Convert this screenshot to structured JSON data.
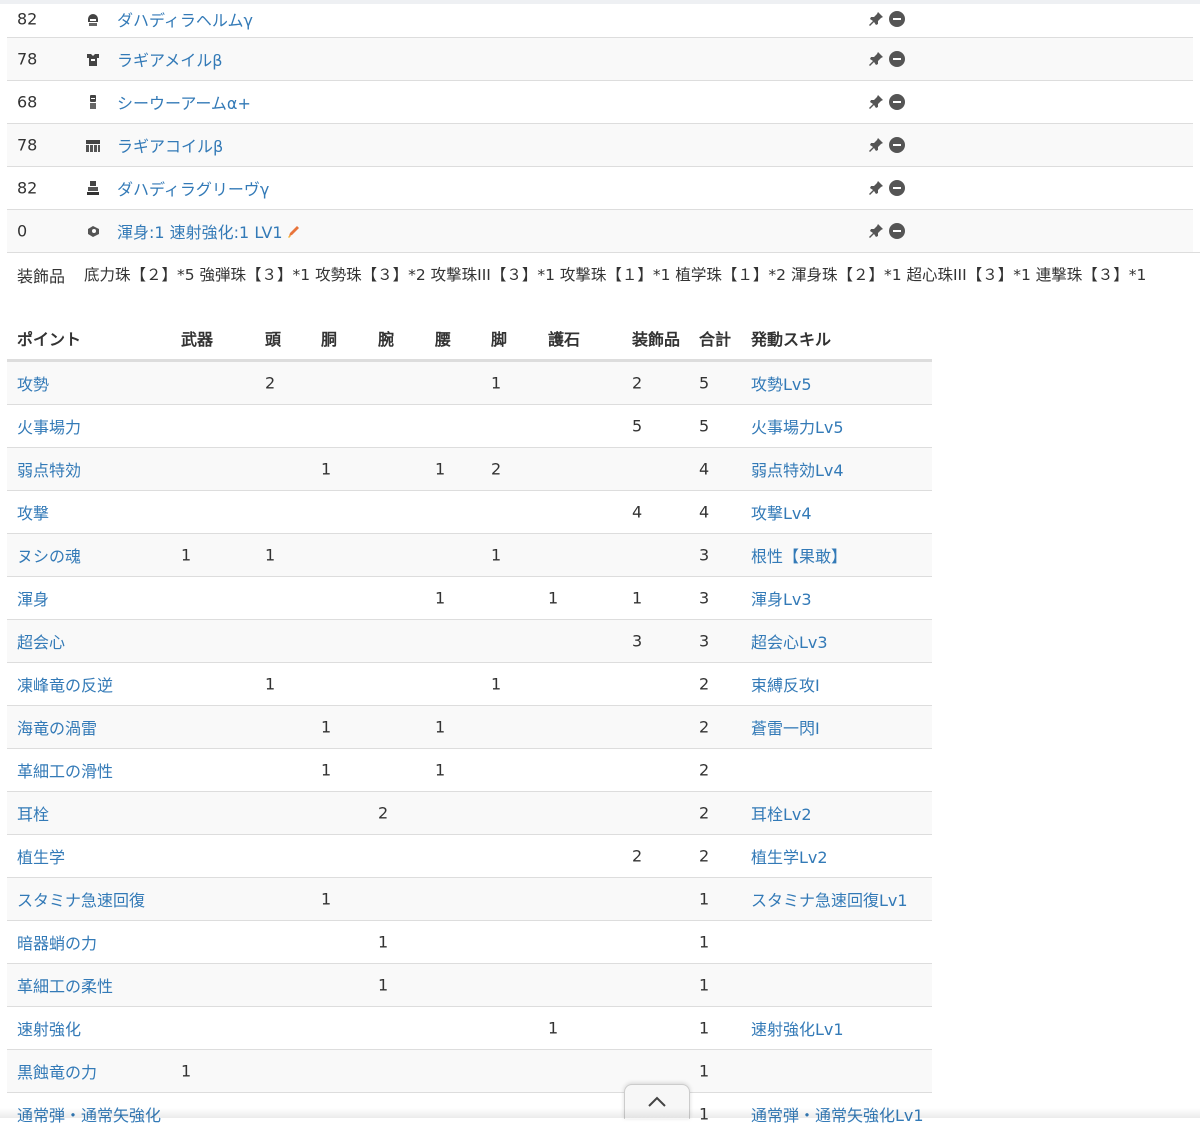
{
  "equipment": [
    {
      "level": "82",
      "icon": "head-armor-icon",
      "name": "ダハディラヘルムγ"
    },
    {
      "level": "78",
      "icon": "chest-armor-icon",
      "name": "ラギアメイルβ"
    },
    {
      "level": "68",
      "icon": "arm-armor-icon",
      "name": "シーウーアームα+"
    },
    {
      "level": "78",
      "icon": "waist-armor-icon",
      "name": "ラギアコイルβ"
    },
    {
      "level": "82",
      "icon": "leg-armor-icon",
      "name": "ダハディラグリーヴγ"
    },
    {
      "level": "0",
      "icon": "charm-icon",
      "name": "渾身:1 速射強化:1 LV1"
    }
  ],
  "decorations": {
    "label": "装飾品",
    "value": "底力珠【２】*5 強弾珠【３】*1 攻勢珠【３】*2 攻撃珠III【３】*1 攻撃珠【１】*1 植学珠【１】*2 渾身珠【２】*1 超心珠III【３】*1 連撃珠【３】*1"
  },
  "skills_table": {
    "headers": [
      "ポイント",
      "武器",
      "頭",
      "胴",
      "腕",
      "腰",
      "脚",
      "護石",
      "装飾品",
      "合計",
      "発動スキル"
    ],
    "rows": [
      [
        "攻勢",
        "",
        "2",
        "",
        "",
        "",
        "1",
        "",
        "2",
        "5",
        "攻勢Lv5"
      ],
      [
        "火事場力",
        "",
        "",
        "",
        "",
        "",
        "",
        "",
        "5",
        "5",
        "火事場力Lv5"
      ],
      [
        "弱点特効",
        "",
        "",
        "1",
        "",
        "1",
        "2",
        "",
        "",
        "4",
        "弱点特効Lv4"
      ],
      [
        "攻撃",
        "",
        "",
        "",
        "",
        "",
        "",
        "",
        "4",
        "4",
        "攻撃Lv4"
      ],
      [
        "ヌシの魂",
        "1",
        "1",
        "",
        "",
        "",
        "1",
        "",
        "",
        "3",
        "根性【果敢】"
      ],
      [
        "渾身",
        "",
        "",
        "",
        "",
        "1",
        "",
        "1",
        "1",
        "3",
        "渾身Lv3"
      ],
      [
        "超会心",
        "",
        "",
        "",
        "",
        "",
        "",
        "",
        "3",
        "3",
        "超会心Lv3"
      ],
      [
        "凍峰竜の反逆",
        "",
        "1",
        "",
        "",
        "",
        "1",
        "",
        "",
        "2",
        "束縛反攻Ⅰ"
      ],
      [
        "海竜の渦雷",
        "",
        "",
        "1",
        "",
        "1",
        "",
        "",
        "",
        "2",
        "蒼雷一閃Ⅰ"
      ],
      [
        "革細工の滑性",
        "",
        "",
        "1",
        "",
        "1",
        "",
        "",
        "",
        "2",
        ""
      ],
      [
        "耳栓",
        "",
        "",
        "",
        "2",
        "",
        "",
        "",
        "",
        "2",
        "耳栓Lv2"
      ],
      [
        "植生学",
        "",
        "",
        "",
        "",
        "",
        "",
        "",
        "2",
        "2",
        "植生学Lv2"
      ],
      [
        "スタミナ急速回復",
        "",
        "",
        "1",
        "",
        "",
        "",
        "",
        "",
        "1",
        "スタミナ急速回復Lv1"
      ],
      [
        "暗器蛸の力",
        "",
        "",
        "",
        "1",
        "",
        "",
        "",
        "",
        "1",
        ""
      ],
      [
        "革細工の柔性",
        "",
        "",
        "",
        "1",
        "",
        "",
        "",
        "",
        "1",
        ""
      ],
      [
        "速射強化",
        "",
        "",
        "",
        "",
        "",
        "",
        "1",
        "",
        "1",
        "速射強化Lv1"
      ],
      [
        "黒蝕竜の力",
        "1",
        "",
        "",
        "",
        "",
        "",
        "",
        "",
        "1",
        ""
      ],
      [
        "通常弾・通常矢強化",
        "",
        "",
        "",
        "",
        "",
        "",
        "",
        "",
        "1",
        "通常弾・通常矢強化Lv1"
      ]
    ]
  },
  "icons": {
    "pin": "pin-icon",
    "remove": "remove-circle-icon",
    "scroll_top": "chevron-up-icon"
  },
  "colors": {
    "link": "#337ab7",
    "stripe": "#f9f9f9",
    "border": "#dddddd"
  }
}
